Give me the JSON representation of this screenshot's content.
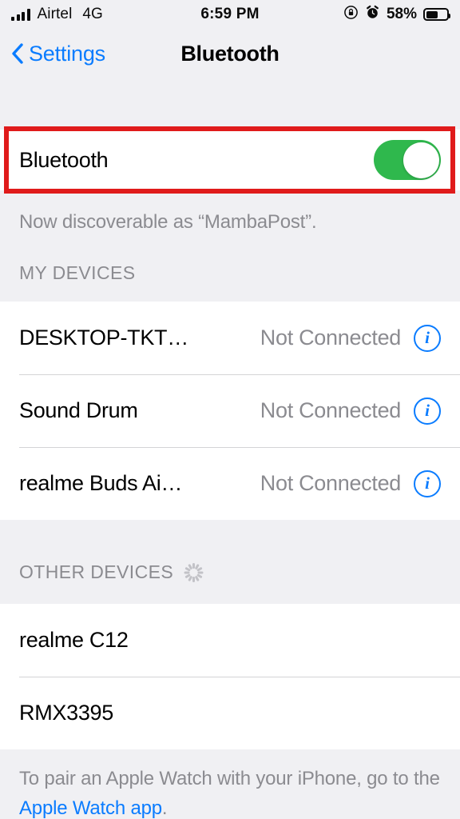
{
  "status_bar": {
    "carrier": "Airtel",
    "network": "4G",
    "time": "6:59 PM",
    "battery_percent": "58%",
    "signal_bars": 4,
    "icons": [
      "signal-bars-icon",
      "rotation-lock-icon",
      "alarm-clock-icon",
      "battery-icon"
    ]
  },
  "nav": {
    "back_label": "Settings",
    "title": "Bluetooth"
  },
  "bluetooth": {
    "label": "Bluetooth",
    "toggle_on": true,
    "toggle_color": "#2fb84d",
    "highlight_color": "#e01b1b",
    "caption": "Now discoverable as “MambaPost”."
  },
  "my_devices": {
    "header": "MY DEVICES",
    "rows": [
      {
        "name": "DESKTOP-TKT…",
        "status": "Not Connected",
        "info": "i"
      },
      {
        "name": "Sound Drum",
        "status": "Not Connected",
        "info": "i"
      },
      {
        "name": "realme Buds Ai…",
        "status": "Not Connected",
        "info": "i"
      }
    ]
  },
  "other_devices": {
    "header": "OTHER DEVICES",
    "scanning": true,
    "rows": [
      {
        "name": "realme C12"
      },
      {
        "name": "RMX3395"
      }
    ]
  },
  "footer": {
    "text_before": "To pair an Apple Watch with your iPhone, go to the ",
    "link": "Apple Watch app",
    "text_after": "."
  }
}
